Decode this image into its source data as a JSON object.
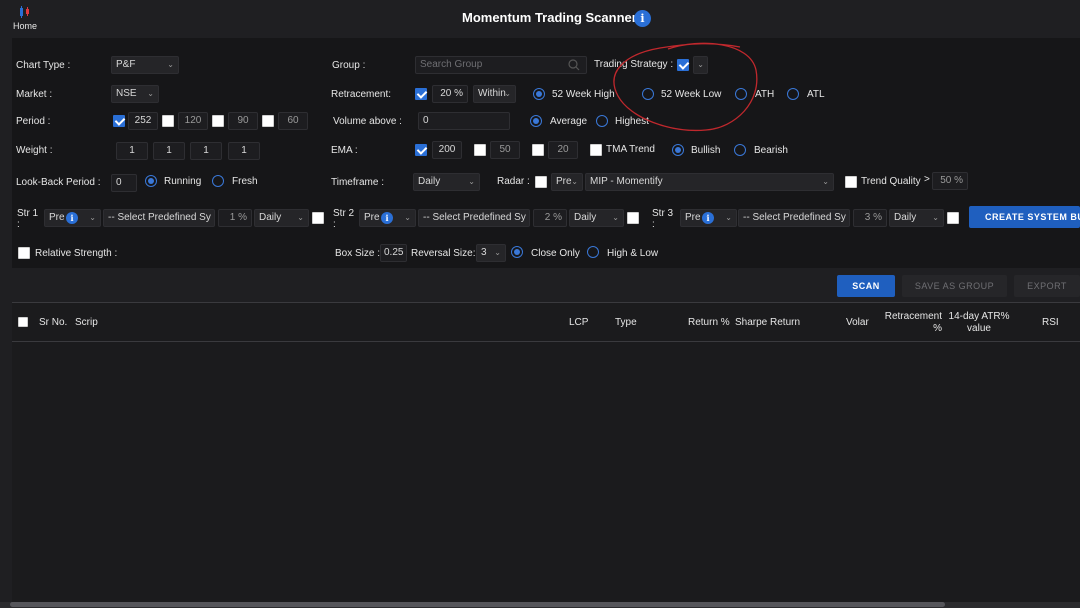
{
  "header": {
    "home_label": "Home",
    "title": "Momentum Trading Scanner",
    "info_glyph": "i"
  },
  "filters": {
    "chart_type": {
      "label": "Chart Type :",
      "value": "P&F"
    },
    "market": {
      "label": "Market :",
      "value": "NSE"
    },
    "period": {
      "label": "Period :",
      "options": [
        {
          "value": "252",
          "checked": true
        },
        {
          "value": "120",
          "checked": false
        },
        {
          "value": "90",
          "checked": false
        },
        {
          "value": "60",
          "checked": false
        }
      ]
    },
    "weight": {
      "label": "Weight :",
      "values": [
        "1",
        "1",
        "1",
        "1"
      ]
    },
    "lookback": {
      "label": "Look-Back Period :",
      "value": "0",
      "options": [
        "Running",
        "Fresh"
      ],
      "selected": "Running"
    },
    "group": {
      "label": "Group :",
      "placeholder": "Search Group"
    },
    "retracement": {
      "label": "Retracement:",
      "checked": true,
      "value": "20",
      "unit": "%",
      "mode": "Within",
      "options": [
        "52 Week High",
        "52 Week Low",
        "ATH",
        "ATL"
      ],
      "selected": "52 Week High"
    },
    "volume": {
      "label": "Volume above :",
      "value": "0",
      "options": [
        "Average",
        "Highest"
      ],
      "selected": "Average"
    },
    "ema": {
      "label": "EMA :",
      "values": [
        {
          "value": "200",
          "checked": true
        },
        {
          "value": "50",
          "checked": false
        },
        {
          "value": "20",
          "checked": false
        }
      ],
      "tma_label": "TMA Trend",
      "tma_checked": false,
      "trend_options": [
        "Bullish",
        "Bearish"
      ],
      "trend_selected": "Bullish"
    },
    "timeframe": {
      "label": "Timeframe :",
      "value": "Daily"
    },
    "radar": {
      "label": "Radar :",
      "checked": false,
      "pre": "Pre",
      "value": "MIP - Momentify"
    },
    "trading_strategy": {
      "label": "Trading Strategy :",
      "checked": true
    },
    "trend_quality": {
      "label": "Trend Quality",
      "checked": false,
      "operator": ">",
      "value": "50",
      "unit": "%"
    },
    "strategies": [
      {
        "label": "Str 1",
        "colon": ":",
        "pre": "Pre",
        "system": "-- Select Predefined Sy",
        "pct": "1",
        "unit": "%",
        "tf": "Daily",
        "checked": false
      },
      {
        "label": "Str 2",
        "colon": ":",
        "pre": "Pre",
        "system": "-- Select Predefined Sy",
        "pct": "2",
        "unit": "%",
        "tf": "Daily",
        "checked": false
      },
      {
        "label": "Str 3",
        "colon": ":",
        "pre": "Pre",
        "system": "-- Select Predefined Sy",
        "pct": "3",
        "unit": "%",
        "tf": "Daily",
        "checked": false
      }
    ],
    "create_system_label": "CREATE SYSTEM BUIL",
    "relative_strength": {
      "label": "Relative Strength :",
      "checked": false
    },
    "box_size": {
      "label": "Box Size :",
      "value": "0.25"
    },
    "reversal_size": {
      "label": "Reversal Size:",
      "value": "3"
    },
    "price_mode": {
      "options": [
        "Close Only",
        "High & Low"
      ],
      "selected": "Close Only"
    }
  },
  "actions": {
    "scan": "SCAN",
    "save_group": "SAVE AS GROUP",
    "export": "EXPORT"
  },
  "table": {
    "columns": [
      "Sr No.",
      "Scrip",
      "LCP",
      "Type",
      "Return %",
      "Sharpe Return",
      "Volar",
      "Retracement %",
      "14-day ATR% value",
      "RSI"
    ],
    "rows": []
  },
  "colors": {
    "accent": "#2a6fd6",
    "annotation": "#c0282d",
    "background": "#1f1f22"
  }
}
